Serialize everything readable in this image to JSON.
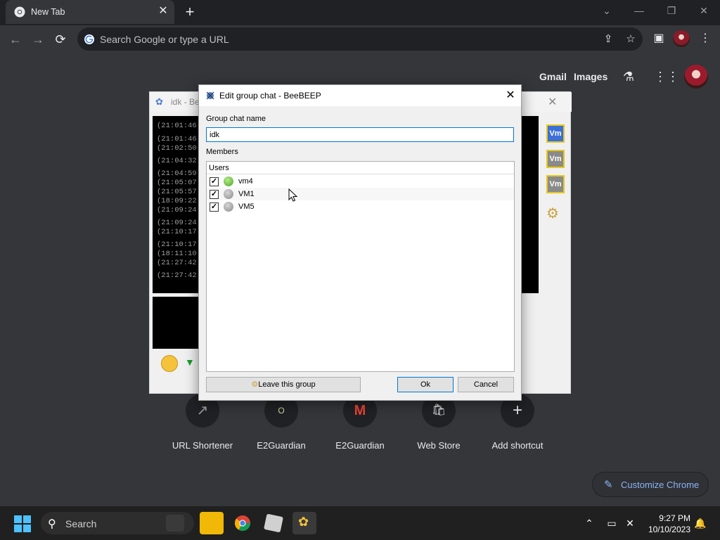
{
  "browser": {
    "tab_title": "New Tab",
    "tab_close": "✕",
    "new_tab": "+",
    "window_controls": [
      "⌄",
      "—",
      "❐",
      "✕"
    ],
    "omnibox_placeholder": "Search Google or type a URL",
    "nav": {
      "back": "←",
      "forward": "→",
      "reload": "⟳"
    }
  },
  "ntp": {
    "links": [
      "Gmail",
      "Images"
    ],
    "shortcuts": [
      {
        "label": "URL Shortener",
        "glyph": "↗"
      },
      {
        "label": "E2Guardian",
        "glyph": "O"
      },
      {
        "label": "E2Guardian",
        "glyph": "M"
      },
      {
        "label": "Web Store",
        "glyph": "🛍"
      },
      {
        "label": "Add shortcut",
        "glyph": "+"
      }
    ],
    "customize_label": "Customize Chrome"
  },
  "bg_window": {
    "title": "idk - Be",
    "close": "✕",
    "timestamps": [
      "(21:01:46)",
      "(21:01:46)",
      "(21:02:50)",
      "(21:04:32)",
      "(21:04:59)",
      "(21:05:07)",
      "(21:05:57)",
      "(18:09:22)",
      "(21:09:24)",
      "(21:09:24)",
      "(21:10:17)",
      "(21:10:17)",
      "(18:11:10)",
      "(21:27:42)",
      "(21:27:42)"
    ],
    "vm_badges": [
      "Vm",
      "Vm",
      "Vm"
    ]
  },
  "dialog": {
    "title": "Edit group chat - BeeBEEP",
    "close": "✕",
    "name_label": "Group chat name",
    "name_value": "idk",
    "members_label": "Members",
    "column_header": "Users",
    "members": [
      {
        "name": "vm4",
        "checked": "✓",
        "status_color": "#5cb82e"
      },
      {
        "name": "VM1",
        "checked": "✓",
        "status_color": "#9a9a9a"
      },
      {
        "name": "VM5",
        "checked": "✓",
        "status_color": "#9a9a9a"
      }
    ],
    "leave_button": "Leave this group",
    "ok_button": "Ok",
    "cancel_button": "Cancel"
  },
  "taskbar": {
    "search_label": "Search",
    "time": "9:27 PM",
    "date": "10/10/2023"
  }
}
